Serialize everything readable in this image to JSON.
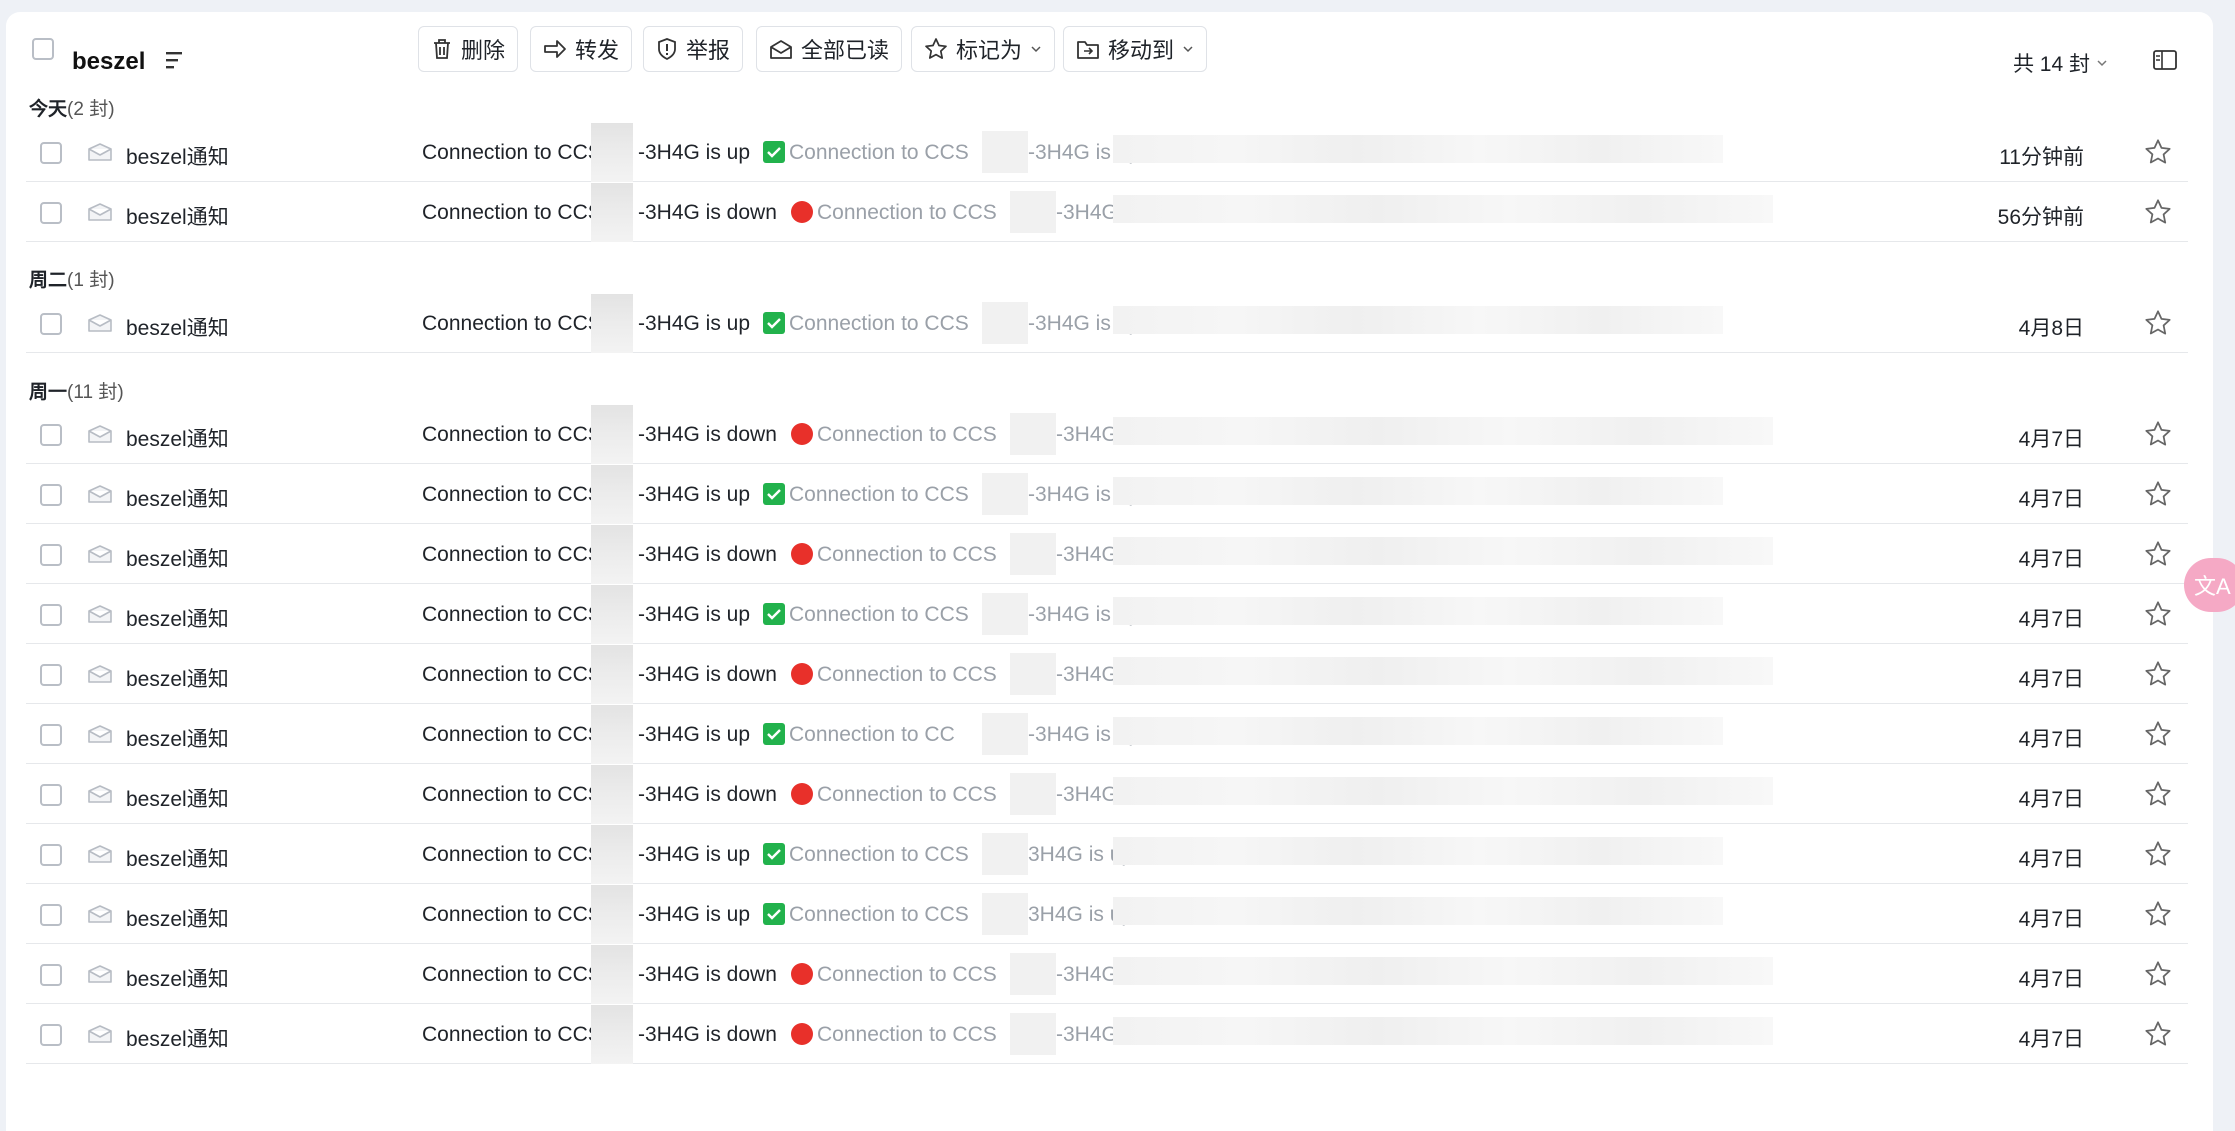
{
  "toolbar": {
    "mailbox_title": "beszel",
    "buttons": {
      "delete": "删除",
      "forward": "转发",
      "report": "举报",
      "mark_all_read": "全部已读",
      "mark_as": "标记为",
      "move_to": "移动到"
    },
    "count": "共 14 封"
  },
  "groups": [
    {
      "name": "今天",
      "count": "(2 封)"
    },
    {
      "name": "周二",
      "count": "(1 封)"
    },
    {
      "name": "周一",
      "count": "(11 封)"
    }
  ],
  "mail_rows": [
    {
      "sender": "beszel通知",
      "subject_prefix": "Connection to CCS",
      "subject_suffix": "-3H4G is up",
      "status": "up",
      "preview_prefix": "Connection to CCS",
      "preview_suffix": "-3H4G is up",
      "date": "11分钟前"
    },
    {
      "sender": "beszel通知",
      "subject_prefix": "Connection to CCS",
      "subject_suffix": "-3H4G is down",
      "status": "down",
      "preview_prefix": "Connection to CCS",
      "preview_suffix": "-3H4G is",
      "date": "56分钟前"
    },
    {
      "sender": "beszel通知",
      "subject_prefix": "Connection to CCS",
      "subject_suffix": "-3H4G is up",
      "status": "up",
      "preview_prefix": "Connection to CCS",
      "preview_suffix": "-3H4G is up",
      "date": "4月8日"
    },
    {
      "sender": "beszel通知",
      "subject_prefix": "Connection to CCS",
      "subject_suffix": "-3H4G is down",
      "status": "down",
      "preview_prefix": "Connection to CCS",
      "preview_suffix": "-3H4G is",
      "date": "4月7日"
    },
    {
      "sender": "beszel通知",
      "subject_prefix": "Connection to CCS",
      "subject_suffix": "-3H4G is up",
      "status": "up",
      "preview_prefix": "Connection to CCS",
      "preview_suffix": "-3H4G is up",
      "date": "4月7日"
    },
    {
      "sender": "beszel通知",
      "subject_prefix": "Connection to CCS",
      "subject_suffix": "-3H4G is down",
      "status": "down",
      "preview_prefix": "Connection to CCS",
      "preview_suffix": "-3H4G is",
      "date": "4月7日"
    },
    {
      "sender": "beszel通知",
      "subject_prefix": "Connection to CCS",
      "subject_suffix": "-3H4G is up",
      "status": "up",
      "preview_prefix": "Connection to CCS",
      "preview_suffix": "-3H4G is up",
      "date": "4月7日"
    },
    {
      "sender": "beszel通知",
      "subject_prefix": "Connection to CCS",
      "subject_suffix": "-3H4G is down",
      "status": "down",
      "preview_prefix": "Connection to CCS",
      "preview_suffix": "-3H4G is",
      "date": "4月7日"
    },
    {
      "sender": "beszel通知",
      "subject_prefix": "Connection to CCS",
      "subject_suffix": "-3H4G is up",
      "status": "up",
      "preview_prefix": "Connection to CC",
      "preview_suffix": "-3H4G is up",
      "date": "4月7日"
    },
    {
      "sender": "beszel通知",
      "subject_prefix": "Connection to CCS",
      "subject_suffix": "-3H4G is down",
      "status": "down",
      "preview_prefix": "Connection to CCS",
      "preview_suffix": "-3H4G is",
      "date": "4月7日"
    },
    {
      "sender": "beszel通知",
      "subject_prefix": "Connection to CCS",
      "subject_suffix": "-3H4G is up",
      "status": "up",
      "preview_prefix": "Connection to CCS",
      "preview_suffix": "3H4G is up",
      "date": "4月7日"
    },
    {
      "sender": "beszel通知",
      "subject_prefix": "Connection to CCS",
      "subject_suffix": "-3H4G is up",
      "status": "up",
      "preview_prefix": "Connection to CCS",
      "preview_suffix": "3H4G is up",
      "date": "4月7日"
    },
    {
      "sender": "beszel通知",
      "subject_prefix": "Connection to CCS",
      "subject_suffix": "-3H4G is down",
      "status": "down",
      "preview_prefix": "Connection to CCS",
      "preview_suffix": "-3H4G is",
      "date": "4月7日"
    },
    {
      "sender": "beszel通知",
      "subject_prefix": "Connection to CCS",
      "subject_suffix": "-3H4G is down",
      "status": "down",
      "preview_prefix": "Connection to CCS",
      "preview_suffix": "-3H4G is",
      "date": "4月7日"
    }
  ],
  "translate_fab_label": "文A",
  "colors": {
    "up": "#22b24c",
    "down": "#e8302a",
    "accent_fab": "#f5a9c5"
  }
}
